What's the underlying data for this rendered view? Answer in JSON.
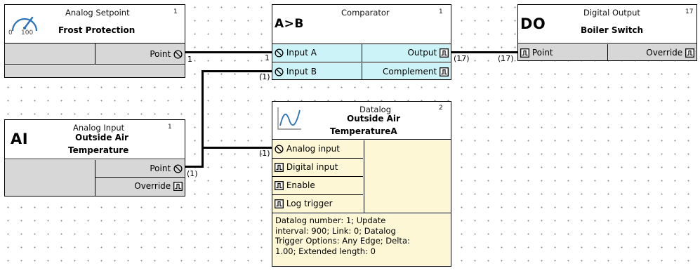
{
  "blocks": {
    "analog_setpoint": {
      "type": "Analog Setpoint",
      "number": "1",
      "name": "Frost Protection",
      "gauge_min": "0",
      "gauge_max": "100",
      "outputs": [
        "Point"
      ]
    },
    "comparator": {
      "type": "Comparator",
      "number": "1",
      "symbol": "A>B",
      "inputs": [
        "Input A",
        "Input B"
      ],
      "outputs": [
        "Output",
        "Complement"
      ]
    },
    "digital_output": {
      "type": "Digital Output",
      "number": "17",
      "symbol": "DO",
      "name": "Boiler Switch",
      "inputs": [
        "Point"
      ],
      "outputs": [
        "Override"
      ]
    },
    "analog_input": {
      "type": "Analog Input",
      "number": "1",
      "symbol": "AI",
      "name_line1": "Outside Air",
      "name_line2": "Temperature",
      "outputs": [
        "Point",
        "Override"
      ]
    },
    "datalog": {
      "type": "Datalog",
      "number": "2",
      "name_line1": "Outside Air",
      "name_line2": "TemperatureA",
      "inputs": [
        "Analog input",
        "Digital input",
        "Enable",
        "Log trigger"
      ],
      "description_lines": [
        "Datalog number: 1; Update",
        "interval: 900; Link: 0; Datalog",
        "Trigger Options: Any Edge; Delta:",
        "1.00; Extended length: 0"
      ]
    }
  },
  "pins": {
    "setpoint_out": "1",
    "comp_in_a": "1",
    "comp_in_b": "(1)",
    "comp_out": "(17)",
    "do_in": "(17)",
    "ai_out": "(1)",
    "datalog_in": "(1)"
  },
  "colors": {
    "grid_dot": "#8a8a8a",
    "header": "#ffffff",
    "gray_row": "#d7d7d7",
    "comparator_io": "#ccf4f8",
    "datalog_body": "#fdf7d6",
    "wire": "#000000"
  },
  "icons": {
    "analog_port": "circle-slash-icon",
    "digital_port": "square-pulse-icon",
    "setpoint": "gauge-icon",
    "datalog": "trend-line-icon"
  }
}
